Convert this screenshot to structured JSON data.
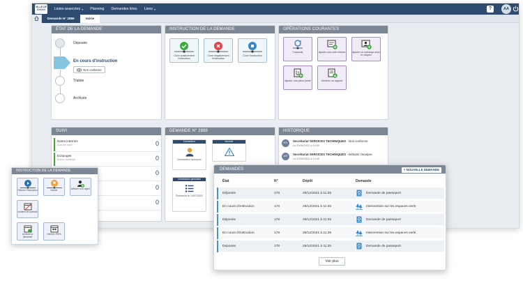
{
  "topbar": {
    "logo_line1": "VILLE DE",
    "logo_line2": "XXXXX",
    "nav": [
      "Listes avancées",
      "Planning",
      "Demandes liées",
      "Liens"
    ],
    "help_label": "?",
    "avatar_initials": "AA"
  },
  "tabs": {
    "demande": "Demande N° 2889",
    "voirie": "Voirie"
  },
  "etat": {
    "title": "ÉTAT DE LA DEMANDE",
    "steps": [
      "Déposée",
      "En cours d'instruction",
      "Traitée",
      "Archivée"
    ],
    "non_conforme_label": "Non conforme"
  },
  "instruction": {
    "title": "INSTRUCTION DE LA DEMANDE",
    "buttons": [
      "Clore positivement l'instruction",
      "Clore négativement l'instruction",
      "Clore l'instruction"
    ]
  },
  "operations": {
    "title": "OPÉRATIONS COURANTES",
    "buttons": [
      "Transmis",
      "Ajouter une note interne",
      "Ajouter un échange avec le citoyen",
      "Ajouter une pièce jointe",
      "Générer un rapport"
    ]
  },
  "suivi": {
    "title": "SUIVI",
    "rows": [
      {
        "label": "Notes internes",
        "sub": "Aucune note",
        "count": "0"
      },
      {
        "label": "Échanges",
        "sub": "Aucun échange",
        "count": "0"
      },
      {
        "label": "",
        "sub": "",
        "count": "0"
      },
      {
        "label": "",
        "sub": "",
        "count": "0"
      },
      {
        "label": "",
        "sub": "",
        "count": "0"
      }
    ]
  },
  "demande_box": {
    "title": "DEMANDE N° 2889",
    "demandeur_head": "Demandeur",
    "demandeur_label": "Demandeur anonyme",
    "associer_head": "Associer",
    "infos_head": "Informations générales",
    "infos_label": "Échéance le 14/07/2022"
  },
  "historique": {
    "title": "HISTORIQUE",
    "items": [
      {
        "badge": "SST",
        "author": "Secrétariat SERVICES TECHNIQUES",
        "action": " - Non conforme",
        "date": "Le 20/06/2022 à 14:49"
      },
      {
        "badge": "SST",
        "author": "Secrétariat SERVICES TECHNIQUES",
        "action": " - Débuter l'analyse",
        "date": "Le 20/06/2022 à 14:49"
      }
    ]
  },
  "instr_popup": {
    "title": "INSTRUCTION DE LA DEMANDE",
    "buttons": [
      "Débuter l'instruction",
      "Interne",
      "Affecter à un agent",
      "Incident de contrôle",
      "Archiver la demande",
      "Générer PDFs"
    ]
  },
  "demandes": {
    "title": "DEMANDES",
    "new_button": "+ Nouvelle demande",
    "columns": [
      "État",
      "N°",
      "Dépôt",
      "Demande"
    ],
    "rows": [
      {
        "etat": "Déposée",
        "num": "178",
        "depot": "29/12/2021 à 11:35",
        "demande": "Demande de passeport",
        "icon": "passport-icon"
      },
      {
        "etat": "En cours d'instruction",
        "num": "178",
        "depot": "29/12/2021 à 11:35",
        "demande": "Intervention sur les espaces verts",
        "icon": "green-space-icon"
      },
      {
        "etat": "Déposée",
        "num": "178",
        "depot": "29/12/2021 à 11:35",
        "demande": "Demande de passeport",
        "icon": "passport-icon"
      },
      {
        "etat": "En cours d'instruction",
        "num": "178",
        "depot": "29/12/2021 à 11:35",
        "demande": "Intervention sur les espaces verts",
        "icon": "green-space-icon"
      },
      {
        "etat": "Déposée",
        "num": "178",
        "depot": "29/12/2021 à 11:35",
        "demande": "Demande de passeport",
        "icon": "passport-icon"
      }
    ],
    "voir_plus": "Voir plus"
  },
  "colors": {
    "navy": "#2e4a6e",
    "panel_header": "#7b8794",
    "green": "#3aaa3a",
    "red": "#e0454a",
    "blue": "#3a87c8"
  }
}
